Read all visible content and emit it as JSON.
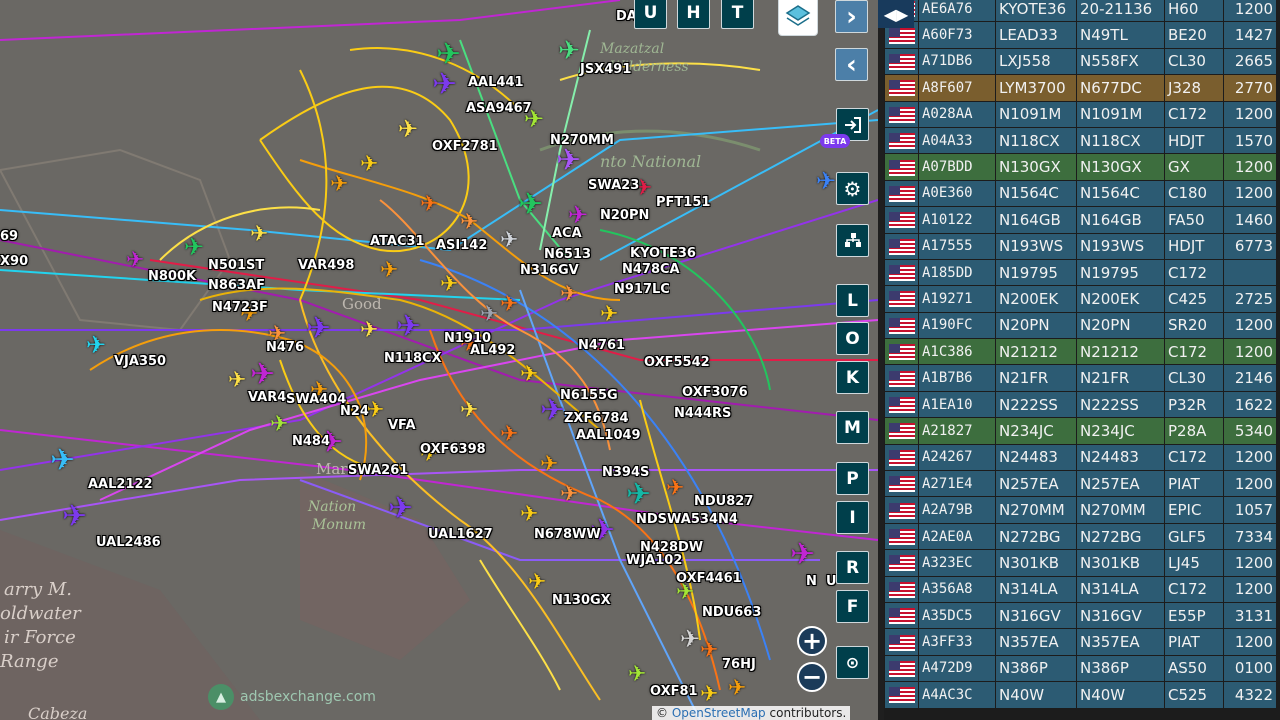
{
  "map": {
    "places": [
      "arry M.",
      "oldwater",
      "ir Force",
      "Range",
      "Cabeza"
    ],
    "partial_labels": [
      "Mazatzal",
      "Wilderness",
      "nto National",
      "Good",
      "Maric",
      "Nation",
      "Monum"
    ],
    "watermark": "adsbexchange.com",
    "attribution": {
      "prefix": "©",
      "link": "OpenStreetMap",
      "suffix": "contributors."
    },
    "aircraft_labels": [
      "AAL441",
      "ASA9467",
      "OXF2781",
      "JSX491",
      "N270MM",
      "PFT151",
      "SWA23",
      "ACA",
      "N20PN",
      "KYOTE36",
      "N478CA",
      "N917LC",
      "N501ST",
      "N800K",
      "N863AF",
      "VAR498",
      "ATAC31",
      "ASI142",
      "N316GV",
      "N6513",
      "VJA350",
      "VAR4",
      "SWA404",
      "N24",
      "N484",
      "SWA261",
      "OXF6398",
      "VFA",
      "N6155G",
      "ZXF6784",
      "AAL1049",
      "OXF5542",
      "OXF3076",
      "N444RS",
      "AAL2122",
      "UAL2486",
      "UAL1627",
      "N678WW",
      "NDSWA534N4",
      "N428DW",
      "WJA102",
      "OXF4461",
      "N130GX",
      "NDU663",
      "NDU827",
      "N394S",
      "76HJ",
      "OXF81",
      "N476",
      "N118CX",
      "AL492",
      "N4761",
      "N4723F",
      "N",
      "69",
      "X90",
      "U",
      "DA",
      "N1910"
    ],
    "controls": {
      "top_buttons": [
        "U",
        "H",
        "T"
      ],
      "side_letters": [
        "L",
        "O",
        "K",
        "M",
        "P",
        "I",
        "R",
        "F"
      ],
      "beta_badge": "BETA",
      "zoom_in": "+",
      "zoom_out": "−"
    },
    "icons": {
      "layers": "layers-icon",
      "next": "chevron-right-icon",
      "prev": "chevron-left-icon",
      "login": "login-icon",
      "settings": "gear-icon",
      "filter": "filter-icon",
      "replay": "replay-icon"
    }
  },
  "sidebar": {
    "collapse_icon": "◀▶",
    "rows": [
      {
        "hex": "AE6A76",
        "callsign": "KYOTE36",
        "reg": "20-21136",
        "type": "H60",
        "squawk": "1200"
      },
      {
        "hex": "A60F73",
        "callsign": "LEAD33",
        "reg": "N49TL",
        "type": "BE20",
        "squawk": "1427"
      },
      {
        "hex": "A71DB6",
        "callsign": "LXJ558",
        "reg": "N558FX",
        "type": "CL30",
        "squawk": "2665"
      },
      {
        "hex": "A8F607",
        "callsign": "LYM3700",
        "reg": "N677DC",
        "type": "J328",
        "squawk": "2770",
        "state": "selected"
      },
      {
        "hex": "A028AA",
        "callsign": "N1091M",
        "reg": "N1091M",
        "type": "C172",
        "squawk": "1200"
      },
      {
        "hex": "A04A33",
        "callsign": "N118CX",
        "reg": "N118CX",
        "type": "HDJT",
        "squawk": "1570"
      },
      {
        "hex": "A07BDD",
        "callsign": "N130GX",
        "reg": "N130GX",
        "type": "GX",
        "squawk": "1200",
        "state": "green"
      },
      {
        "hex": "A0E360",
        "callsign": "N1564C",
        "reg": "N1564C",
        "type": "C180",
        "squawk": "1200"
      },
      {
        "hex": "A10122",
        "callsign": "N164GB",
        "reg": "N164GB",
        "type": "FA50",
        "squawk": "1460"
      },
      {
        "hex": "A17555",
        "callsign": "N193WS",
        "reg": "N193WS",
        "type": "HDJT",
        "squawk": "6773"
      },
      {
        "hex": "A185DD",
        "callsign": "N19795",
        "reg": "N19795",
        "type": "C172",
        "squawk": ""
      },
      {
        "hex": "A19271",
        "callsign": "N200EK",
        "reg": "N200EK",
        "type": "C425",
        "squawk": "2725"
      },
      {
        "hex": "A190FC",
        "callsign": "N20PN",
        "reg": "N20PN",
        "type": "SR20",
        "squawk": "1200"
      },
      {
        "hex": "A1C386",
        "callsign": "N21212",
        "reg": "N21212",
        "type": "C172",
        "squawk": "1200",
        "state": "green"
      },
      {
        "hex": "A1B7B6",
        "callsign": "N21FR",
        "reg": "N21FR",
        "type": "CL30",
        "squawk": "2146"
      },
      {
        "hex": "A1EA10",
        "callsign": "N222SS",
        "reg": "N222SS",
        "type": "P32R",
        "squawk": "1622"
      },
      {
        "hex": "A21827",
        "callsign": "N234JC",
        "reg": "N234JC",
        "type": "P28A",
        "squawk": "5340",
        "state": "green"
      },
      {
        "hex": "A24267",
        "callsign": "N24483",
        "reg": "N24483",
        "type": "C172",
        "squawk": "1200"
      },
      {
        "hex": "A271E4",
        "callsign": "N257EA",
        "reg": "N257EA",
        "type": "PIAT",
        "squawk": "1200"
      },
      {
        "hex": "A2A79B",
        "callsign": "N270MM",
        "reg": "N270MM",
        "type": "EPIC",
        "squawk": "1057"
      },
      {
        "hex": "A2AE0A",
        "callsign": "N272BG",
        "reg": "N272BG",
        "type": "GLF5",
        "squawk": "7334"
      },
      {
        "hex": "A323EC",
        "callsign": "N301KB",
        "reg": "N301KB",
        "type": "LJ45",
        "squawk": "1200"
      },
      {
        "hex": "A356A8",
        "callsign": "N314LA",
        "reg": "N314LA",
        "type": "C172",
        "squawk": "1200"
      },
      {
        "hex": "A35DC5",
        "callsign": "N316GV",
        "reg": "N316GV",
        "type": "E55P",
        "squawk": "3131"
      },
      {
        "hex": "A3FF33",
        "callsign": "N357EA",
        "reg": "N357EA",
        "type": "PIAT",
        "squawk": "1200"
      },
      {
        "hex": "A472D9",
        "callsign": "N386P",
        "reg": "N386P",
        "type": "AS50",
        "squawk": "0100"
      },
      {
        "hex": "A4AC3C",
        "callsign": "N40W",
        "reg": "N40W",
        "type": "C525",
        "squawk": "4322"
      }
    ]
  }
}
